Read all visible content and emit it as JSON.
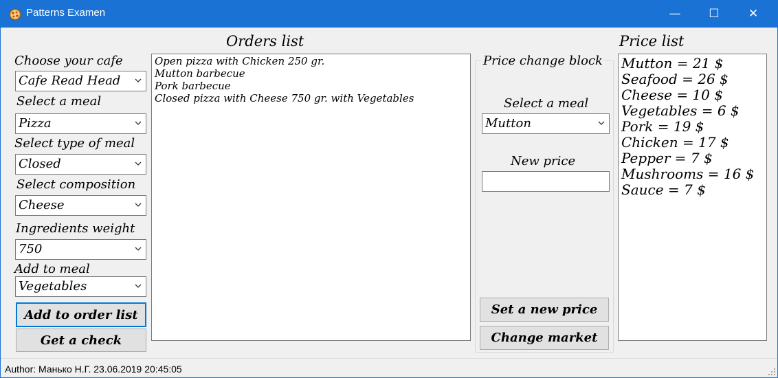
{
  "window": {
    "title": "Patterns Examen",
    "minimize_symbol": "—",
    "maximize_symbol": "☐",
    "close_symbol": "✕",
    "titlebar_color": "#1a73d4"
  },
  "left_panel": {
    "cafe_label": "Choose your cafe",
    "cafe_value": "Cafe Read Head",
    "meal_label": "Select a meal",
    "meal_value": "Pizza",
    "type_label": "Select type of meal",
    "type_value": "Closed",
    "composition_label": "Select composition",
    "composition_value": "Cheese",
    "weight_label": "Ingredients weight",
    "weight_value": "750",
    "add_label": "Add to meal",
    "add_value": "Vegetables",
    "add_to_order_button": "Add to order list",
    "get_check_button": "Get a check"
  },
  "orders": {
    "title": "Orders list",
    "items": [
      "Open pizza with Chicken 250 gr.",
      "Mutton barbecue",
      "Pork barbecue",
      "Closed pizza with Cheese 750 gr. with Vegetables"
    ]
  },
  "price_change": {
    "group_title": "Price change block",
    "meal_label": "Select a meal",
    "meal_value": "Mutton",
    "new_price_label": "New price",
    "new_price_value": "",
    "set_price_button": "Set a new price",
    "change_market_button": "Change market"
  },
  "price_list": {
    "title": "Price list",
    "items": [
      "Mutton = 21 $",
      "Seafood = 26 $",
      "Cheese = 10 $",
      "Vegetables = 6 $",
      "Pork = 19 $",
      "Chicken = 17 $",
      "Pepper = 7 $",
      "Mushrooms = 16 $",
      "Sauce = 7 $"
    ]
  },
  "status": {
    "text": "Author:  Манько Н.Г.  23.06.2019  20:45:05"
  },
  "icons": {
    "app": "pizza-icon",
    "dropdown": "chevron-down-icon",
    "grip": "resize-grip-icon"
  }
}
